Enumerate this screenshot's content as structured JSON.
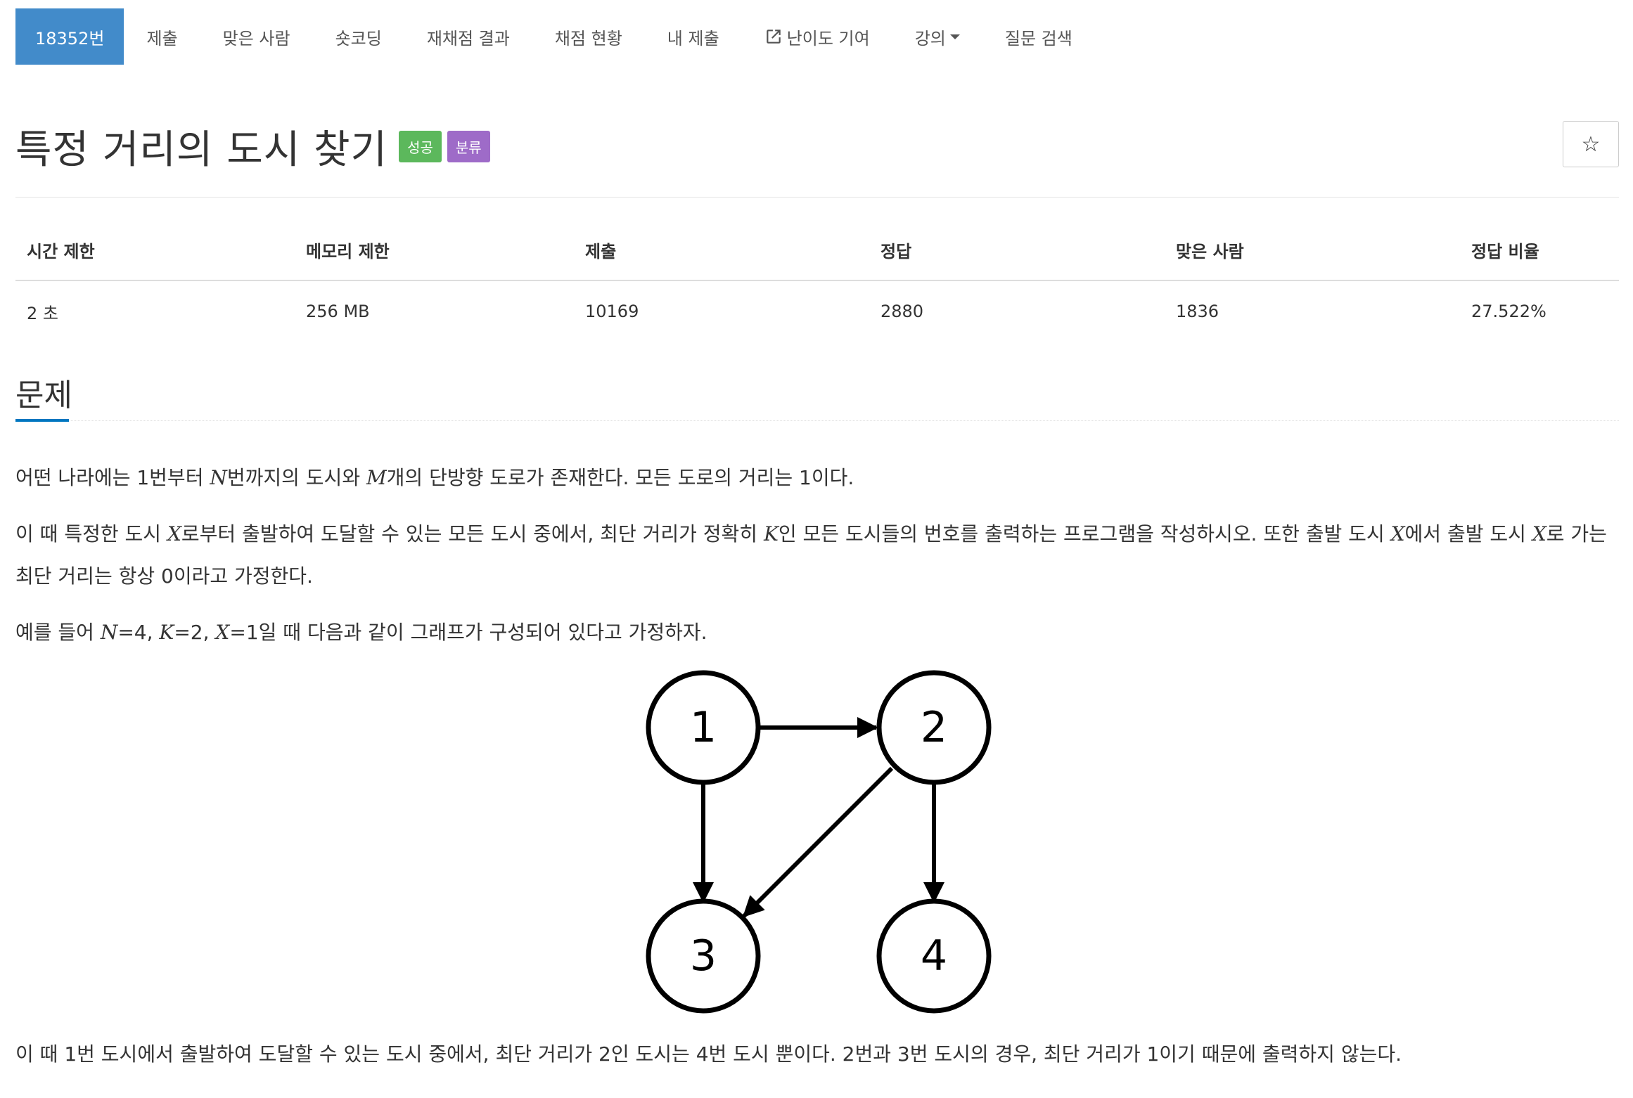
{
  "nav": {
    "problem_id": "18352번",
    "submit": "제출",
    "solved_users": "맞은 사람",
    "shortest_code": "숏코딩",
    "rejudge_result": "재채점 결과",
    "judge_status": "채점 현황",
    "my_submissions": "내 제출",
    "contribute_difficulty": "난이도 기여",
    "lectures": "강의",
    "question_search": "질문 검색"
  },
  "title": {
    "text": "특정 거리의 도시 찾기",
    "badge_success": "성공",
    "badge_category": "분류",
    "star": "☆"
  },
  "info_table": {
    "headers": [
      "시간 제한",
      "메모리 제한",
      "제출",
      "정답",
      "맞은 사람",
      "정답 비율"
    ],
    "values": [
      "2 초",
      "256 MB",
      "10169",
      "2880",
      "1836",
      "27.522%"
    ]
  },
  "section": {
    "title": "문제"
  },
  "problem": {
    "p1": {
      "a": "어떤 나라에는 1번부터 ",
      "N": "N",
      "b": "번까지의 도시와 ",
      "M": "M",
      "c": "개의 단방향 도로가 존재한다. 모든 도로의 거리는 1이다."
    },
    "p2": {
      "a": "이 때 특정한 도시 ",
      "X1": "X",
      "b": "로부터 출발하여 도달할 수 있는 모든 도시 중에서, 최단 거리가 정확히 ",
      "K": "K",
      "c": "인 모든 도시들의 번호를 출력하는 프로그램을 작성하시오. 또한 출발 도시 ",
      "X2": "X",
      "d": "에서 출발 도시 ",
      "X3": "X",
      "e": "로 가는 최단 거리는 항상 0이라고 가정한다."
    },
    "p3": {
      "a": "예를 들어 ",
      "N": "N",
      "b": "=4, ",
      "K": "K",
      "c": "=2, ",
      "X": "X",
      "d": "=1일 때 다음과 같이 그래프가 구성되어 있다고 가정하자."
    },
    "p4": "이 때 1번 도시에서 출발하여 도달할 수 있는 도시 중에서, 최단 거리가 2인 도시는 4번 도시 뿐이다.  2번과 3번 도시의 경우, 최단 거리가 1이기 때문에 출력하지 않는다."
  },
  "graph": {
    "nodes": [
      "1",
      "2",
      "3",
      "4"
    ],
    "edges": [
      [
        "1",
        "2"
      ],
      [
        "1",
        "3"
      ],
      [
        "2",
        "3"
      ],
      [
        "2",
        "4"
      ]
    ]
  },
  "colors": {
    "nav_active": "#428bca",
    "badge_success": "#5cb85c",
    "badge_category": "#9e6bc8",
    "section_underline": "#0076c0"
  }
}
